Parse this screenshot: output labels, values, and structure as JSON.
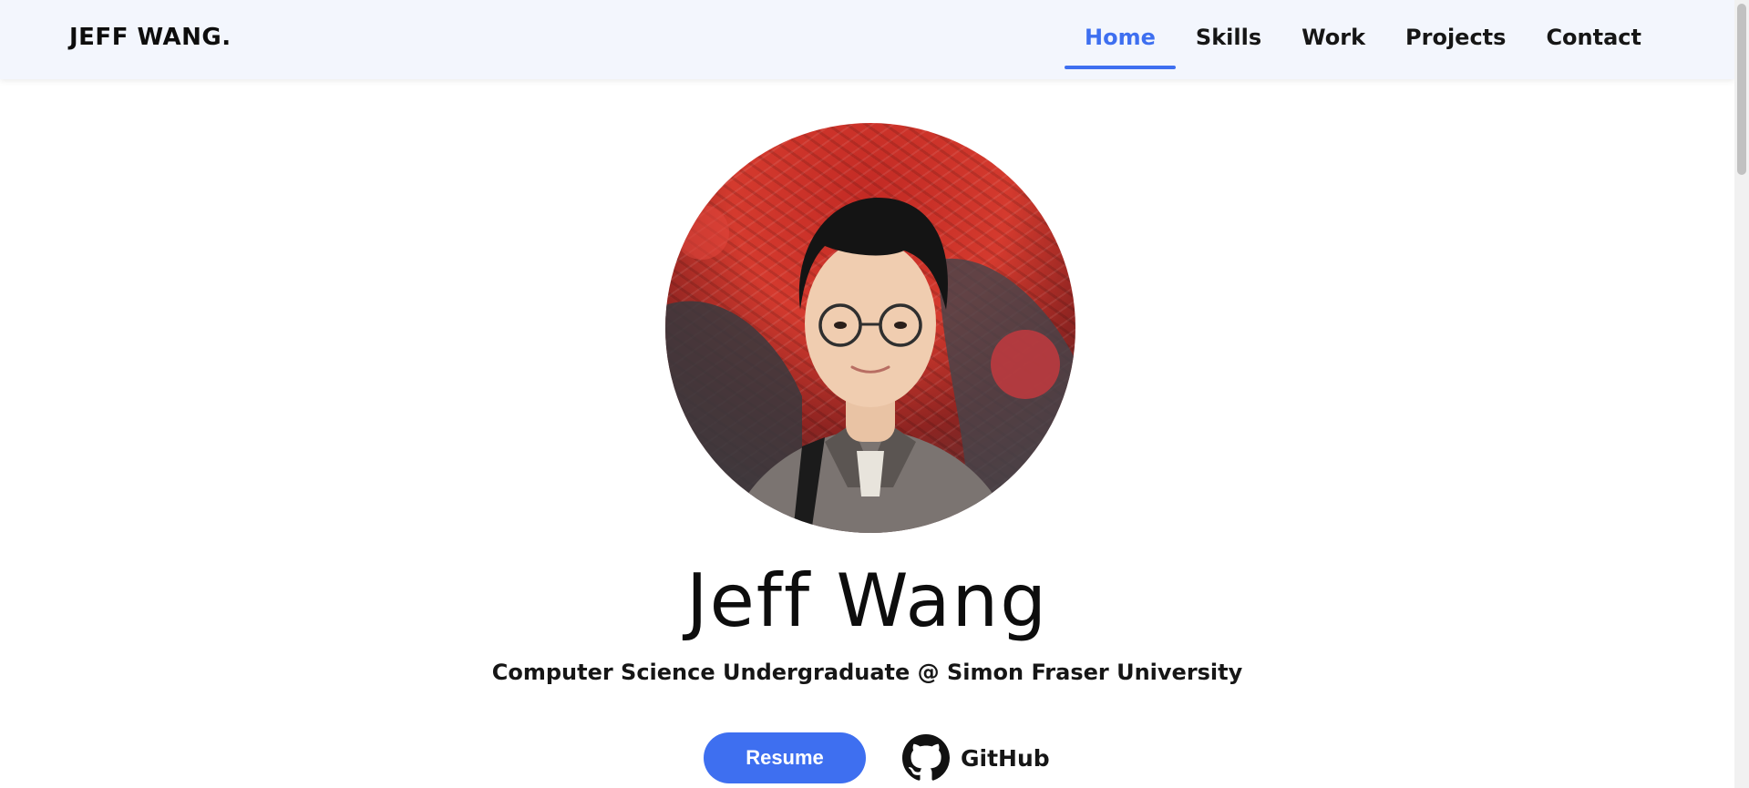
{
  "brand": "JEFF WANG.",
  "nav": {
    "items": [
      {
        "label": "Home",
        "active": true
      },
      {
        "label": "Skills",
        "active": false
      },
      {
        "label": "Work",
        "active": false
      },
      {
        "label": "Projects",
        "active": false
      },
      {
        "label": "Contact",
        "active": false
      }
    ]
  },
  "hero": {
    "name": "Jeff Wang",
    "subtitle": "Computer Science Undergraduate @ Simon Fraser University",
    "resume_label": "Resume",
    "github_label": "GitHub"
  },
  "colors": {
    "accent": "#3e6ff0",
    "navbar_bg": "#f3f6fd",
    "text": "#161616"
  },
  "icons": {
    "github": "github-icon"
  }
}
